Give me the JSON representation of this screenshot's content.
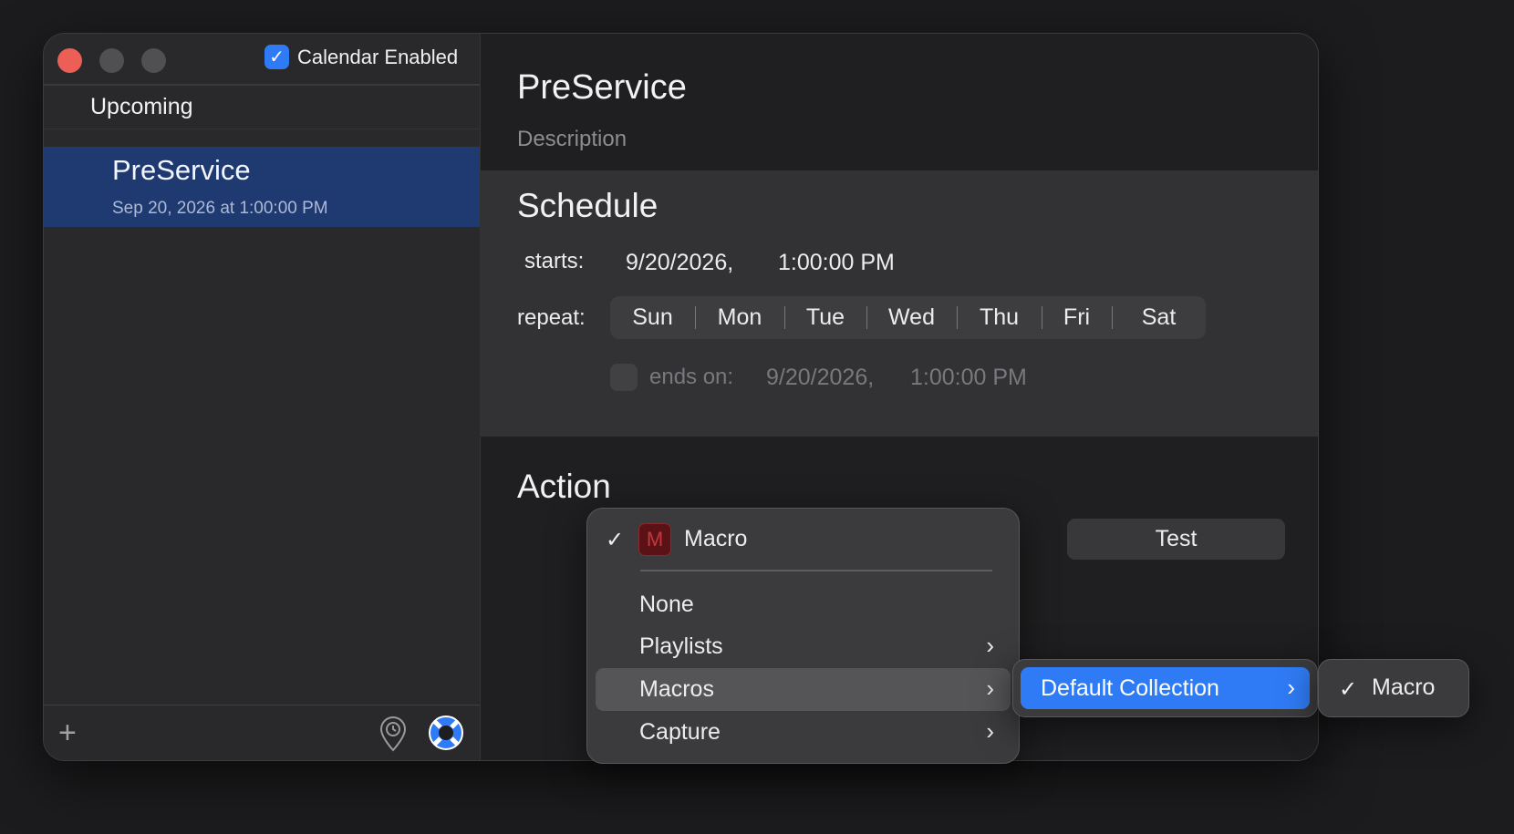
{
  "sidebar": {
    "calendar_enabled_label": "Calendar Enabled",
    "calendar_enabled_checked": true,
    "section_header": "Upcoming",
    "events": [
      {
        "title": "PreService",
        "date": "Sep 20, 2026 at 1:00:00 PM"
      }
    ],
    "add_glyph": "+"
  },
  "main": {
    "title": "PreService",
    "description_placeholder": "Description",
    "schedule": {
      "heading": "Schedule",
      "starts_label": "starts:",
      "starts_date": "9/20/2026,",
      "starts_time": "1:00:00 PM",
      "repeat_label": "repeat:",
      "days": [
        "Sun",
        "Mon",
        "Tue",
        "Wed",
        "Thu",
        "Fri",
        "Sat"
      ],
      "ends_label": "ends on:",
      "ends_date": "9/20/2026,",
      "ends_time": "1:00:00 PM",
      "ends_checked": false
    },
    "action": {
      "heading": "Action",
      "test_label": "Test"
    }
  },
  "action_menu": {
    "selected_label": "Macro",
    "selected_badge": "M",
    "items": [
      {
        "label": "None",
        "submenu": false
      },
      {
        "label": "Playlists",
        "submenu": true
      },
      {
        "label": "Macros",
        "submenu": true,
        "highlighted": true
      },
      {
        "label": "Capture",
        "submenu": true
      }
    ]
  },
  "submenu": {
    "label": "Default Collection"
  },
  "submenu2": {
    "label": "Macro"
  },
  "colors": {
    "accent": "#2f7bf5",
    "selection": "#1e3a70",
    "close": "#ec5f57",
    "macro_badge": "#c0383d"
  }
}
